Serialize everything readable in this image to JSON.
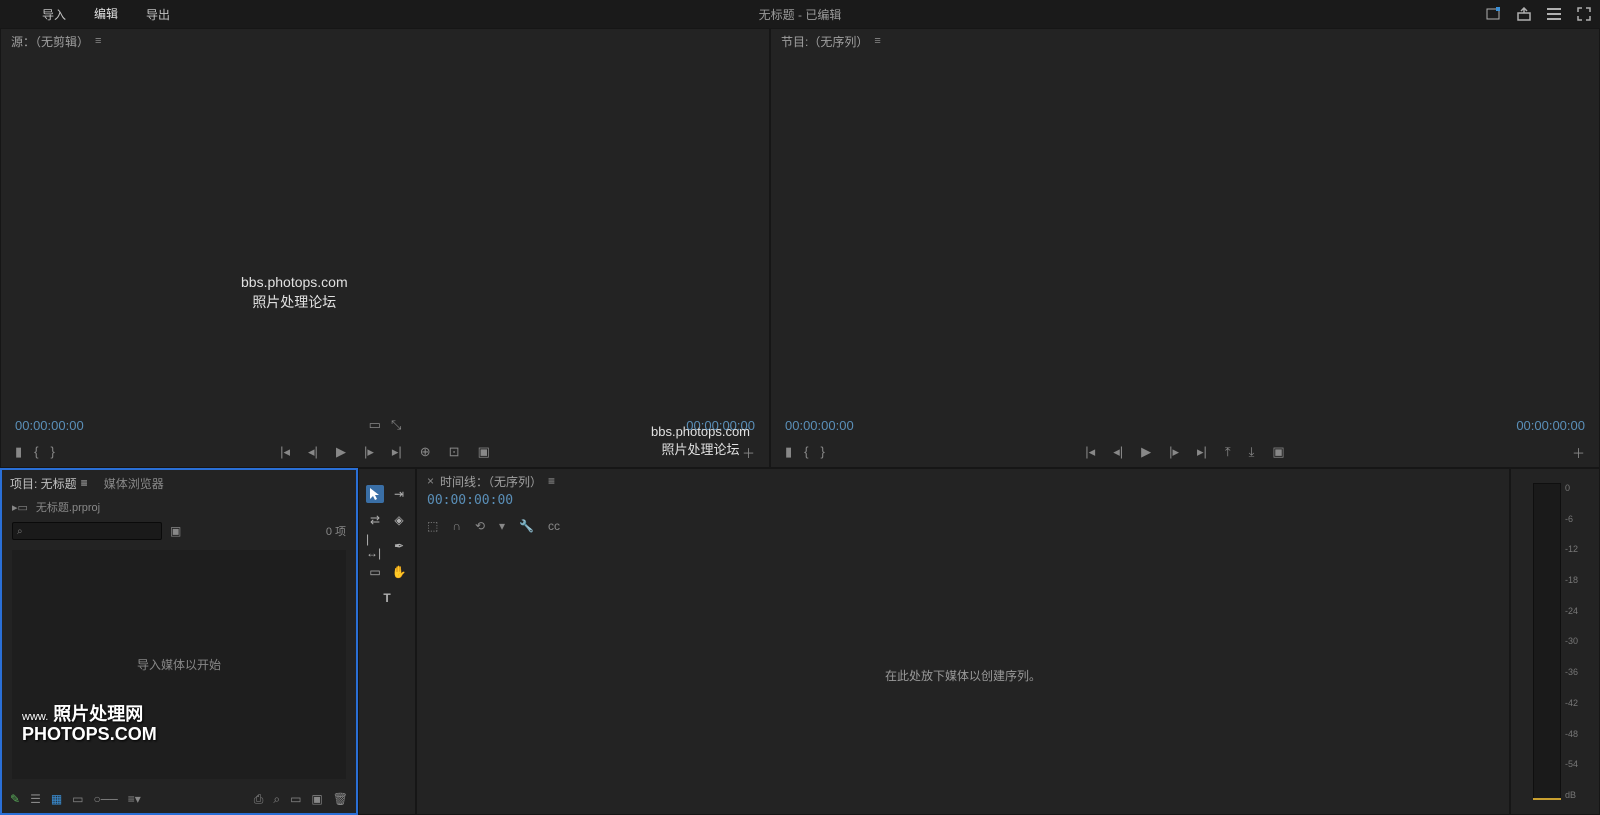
{
  "topbar": {
    "tabs": {
      "import": "导入",
      "edit": "编辑",
      "export": "导出"
    },
    "title": "无标题 - 已编辑"
  },
  "source": {
    "title": "源：（无剪辑）",
    "tc_left": "00:00:00:00",
    "tc_right": "00:00:00:00"
  },
  "program": {
    "title": "节目:（无序列）",
    "tc_left": "00:00:00:00",
    "tc_right": "00:00:00:00"
  },
  "watermark_a": {
    "line1": "bbs.photops.com",
    "line2": "照片处理论坛"
  },
  "watermark_b": {
    "line1": "bbs.photops.com",
    "line2": "照片处理论坛"
  },
  "watermark_c": {
    "small": "www.",
    "big1": "照片处理网",
    "big2": "PHOTOPS.COM"
  },
  "project": {
    "tab_project": "项目: 无标题",
    "tab_media": "媒体浏览器",
    "filename": "无标题.prproj",
    "count": "0 项",
    "empty": "导入媒体以开始"
  },
  "timeline": {
    "title": "时间线：（无序列）",
    "tc": "00:00:00:00",
    "empty": "在此处放下媒体以创建序列。"
  },
  "meter": {
    "ticks": [
      "0",
      "-6",
      "-12",
      "-18",
      "-24",
      "-30",
      "-36",
      "-42",
      "-48",
      "-54",
      "dB"
    ]
  }
}
